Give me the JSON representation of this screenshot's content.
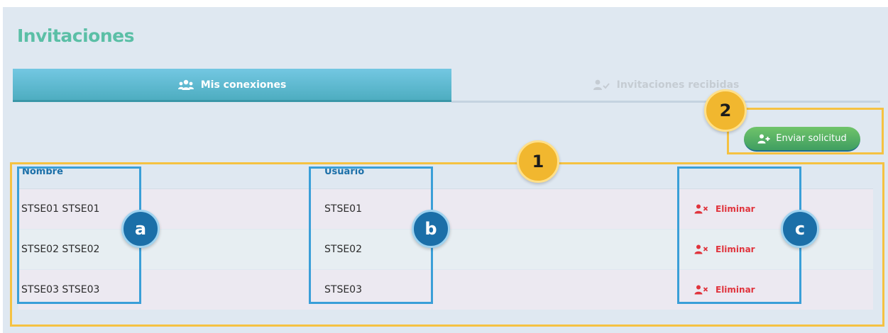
{
  "page": {
    "title": "Invitaciones"
  },
  "tabs": [
    {
      "label": "Mis conexiones",
      "icon": "users-icon",
      "active": true
    },
    {
      "label": "Invitaciones recibidas",
      "icon": "user-check-icon",
      "active": false
    }
  ],
  "actions": {
    "send_request_label": "Enviar solicitud",
    "send_request_icon": "user-plus-icon"
  },
  "table": {
    "columns": [
      "Nombre",
      "Usuario"
    ],
    "rows": [
      {
        "nombre": "STSE01 STSE01",
        "usuario": "STSE01",
        "action": "Eliminar"
      },
      {
        "nombre": "STSE02 STSE02",
        "usuario": "STSE02",
        "action": "Eliminar"
      },
      {
        "nombre": "STSE03 STSE03",
        "usuario": "STSE03",
        "action": "Eliminar"
      }
    ]
  },
  "annotations": {
    "badge_1": "1",
    "badge_2": "2",
    "badge_a": "a",
    "badge_b": "b",
    "badge_c": "c"
  },
  "colors": {
    "title": "#5bbfa6",
    "tab_active": "#4cacbf",
    "send_button": "#4caf64",
    "delete": "#e0333c",
    "header_text": "#1b6fa8",
    "highlight_yellow": "#f5c242",
    "highlight_blue": "#3a9fd8"
  }
}
